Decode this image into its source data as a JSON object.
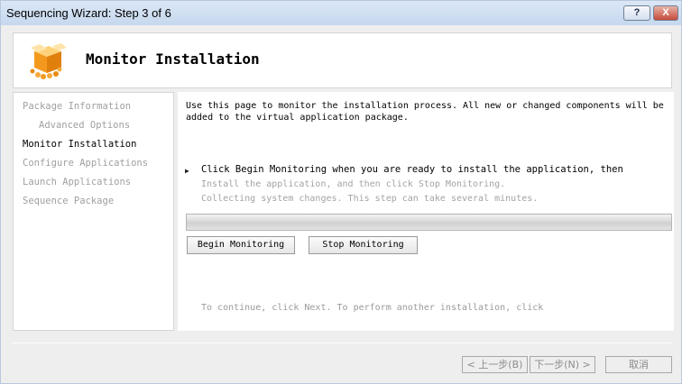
{
  "window": {
    "title": "Sequencing Wizard: Step 3 of 6",
    "help_label": "?",
    "close_label": "X"
  },
  "header": {
    "title": "Monitor Installation",
    "icon": "package-cubes-icon"
  },
  "nav": {
    "items": [
      {
        "label": "Package Information",
        "state": "done"
      },
      {
        "label": "Advanced Options",
        "state": "done"
      },
      {
        "label": "Monitor Installation",
        "state": "current"
      },
      {
        "label": "Configure Applications",
        "state": "pending"
      },
      {
        "label": "Launch Applications",
        "state": "pending"
      },
      {
        "label": "Sequence Package",
        "state": "pending"
      }
    ]
  },
  "content": {
    "intro": "Use this page to monitor the installation process. All new or changed components will be added to the virtual application package.",
    "step_line1": "Click Begin Monitoring when you are ready to install the application, then",
    "step_line2": "Install the application, and then click Stop Monitoring.",
    "step_line3": "Collecting system changes. This step can take several minutes.",
    "progress_fraction": 0,
    "begin_label": "Begin Monitoring",
    "stop_label": "Stop Monitoring",
    "continue_text": "To continue, click Next. To perform another installation, click"
  },
  "footer": {
    "back_label": "< 上一步(B)",
    "next_label": "下一步(N) >",
    "cancel_label": "取消"
  }
}
